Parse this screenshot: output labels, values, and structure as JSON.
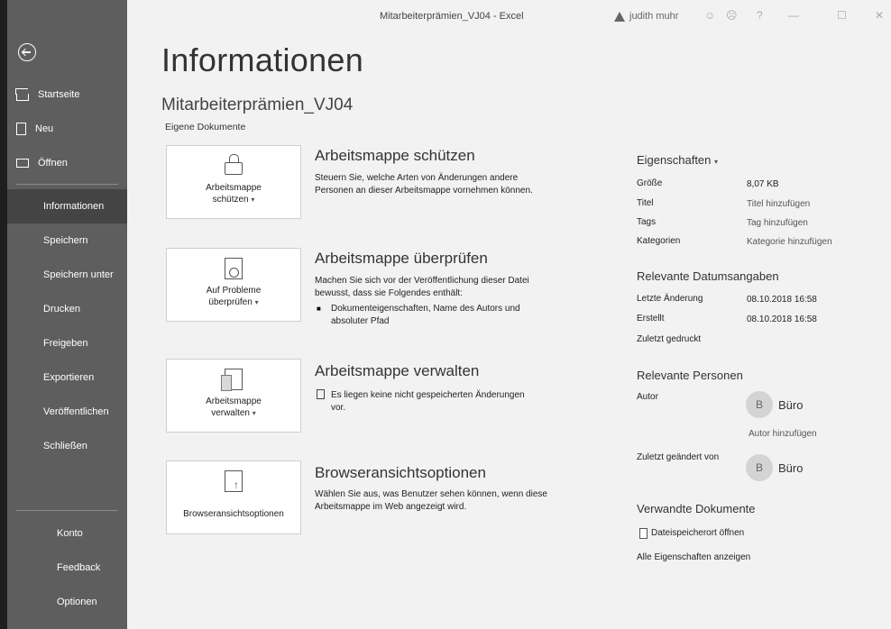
{
  "window": {
    "title": "Mitarbeiterprämien_VJ04 - Excel",
    "user": "judith muhr",
    "controls": [
      "☺",
      "☹",
      "?",
      "—",
      "☐",
      "✕"
    ]
  },
  "sidebar": {
    "top_items": [
      {
        "label": "Startseite",
        "icon": "home-icon"
      },
      {
        "label": "Neu",
        "icon": "new-document-icon"
      },
      {
        "label": "Öffnen",
        "icon": "open-folder-icon"
      }
    ],
    "main_items": [
      "Informationen",
      "Speichern",
      "Speichern unter",
      "Drucken",
      "Freigeben",
      "Exportieren",
      "Veröffentlichen",
      "Schließen"
    ],
    "active": "Informationen",
    "bottom_items": [
      "Konto",
      "Feedback",
      "Optionen"
    ]
  },
  "main": {
    "page_title": "Informationen",
    "doc_name": "Mitarbeiterprämien_VJ04",
    "doc_path": "Eigene Dokumente",
    "sections": [
      {
        "card_label_1": "Arbeitsmappe",
        "card_label_2": "schützen",
        "card_has_dropdown": true,
        "icon": "lock-icon",
        "title": "Arbeitsmappe schützen",
        "text_1": "Steuern Sie, welche Arten von Änderungen andere",
        "text_2": "Personen an dieser Arbeitsmappe vornehmen können."
      },
      {
        "card_label_1": "Auf Probleme",
        "card_label_2": "überprüfen",
        "card_has_dropdown": true,
        "icon": "inspect-document-icon",
        "title": "Arbeitsmappe überprüfen",
        "text_1": "Machen Sie sich vor der Veröffentlichung dieser Datei",
        "text_2": "bewusst, dass sie Folgendes enthält:",
        "bullet_1": "Dokumenteigenschaften, Name des Autors und",
        "bullet_2": "absoluter Pfad"
      },
      {
        "card_label_1": "Arbeitsmappe",
        "card_label_2": "verwalten",
        "card_has_dropdown": true,
        "icon": "manage-workbook-icon",
        "title": "Arbeitsmappe verwalten",
        "text_1": "Es liegen keine nicht gespeicherten Änderungen",
        "text_2": "vor."
      },
      {
        "card_label_1": "Browseransichtsoptionen",
        "card_has_dropdown": false,
        "icon": "browser-view-icon",
        "title": "Browseransichtsoptionen",
        "text_1": "Wählen Sie aus, was Benutzer sehen können, wenn diese",
        "text_2": "Arbeitsmappe im Web angezeigt wird."
      }
    ]
  },
  "properties": {
    "heading": "Eigenschaften",
    "rows": [
      {
        "label": "Größe",
        "value": "8,07 KB"
      },
      {
        "label": "Titel",
        "value": "Titel hinzufügen"
      },
      {
        "label": "Tags",
        "value": "Tag hinzufügen"
      },
      {
        "label": "Kategorien",
        "value": "Kategorie hinzufügen"
      }
    ]
  },
  "dates": {
    "heading": "Relevante Datumsangaben",
    "rows": [
      {
        "label": "Letzte Änderung",
        "value": "08.10.2018 16:58"
      },
      {
        "label": "Erstellt",
        "value": "08.10.2018 16:58"
      },
      {
        "label": "Zuletzt gedruckt",
        "value": ""
      }
    ]
  },
  "people": {
    "heading": "Relevante Personen",
    "author_label": "Autor",
    "author_initial": "B",
    "author_name": "Büro",
    "add_author": "Autor hinzufügen",
    "modified_label": "Zuletzt geändert von",
    "modified_initial": "B",
    "modified_name": "Büro"
  },
  "related": {
    "heading": "Verwandte Dokumente",
    "open_location": "Dateispeicherort öffnen",
    "show_all": "Alle Eigenschaften anzeigen"
  }
}
